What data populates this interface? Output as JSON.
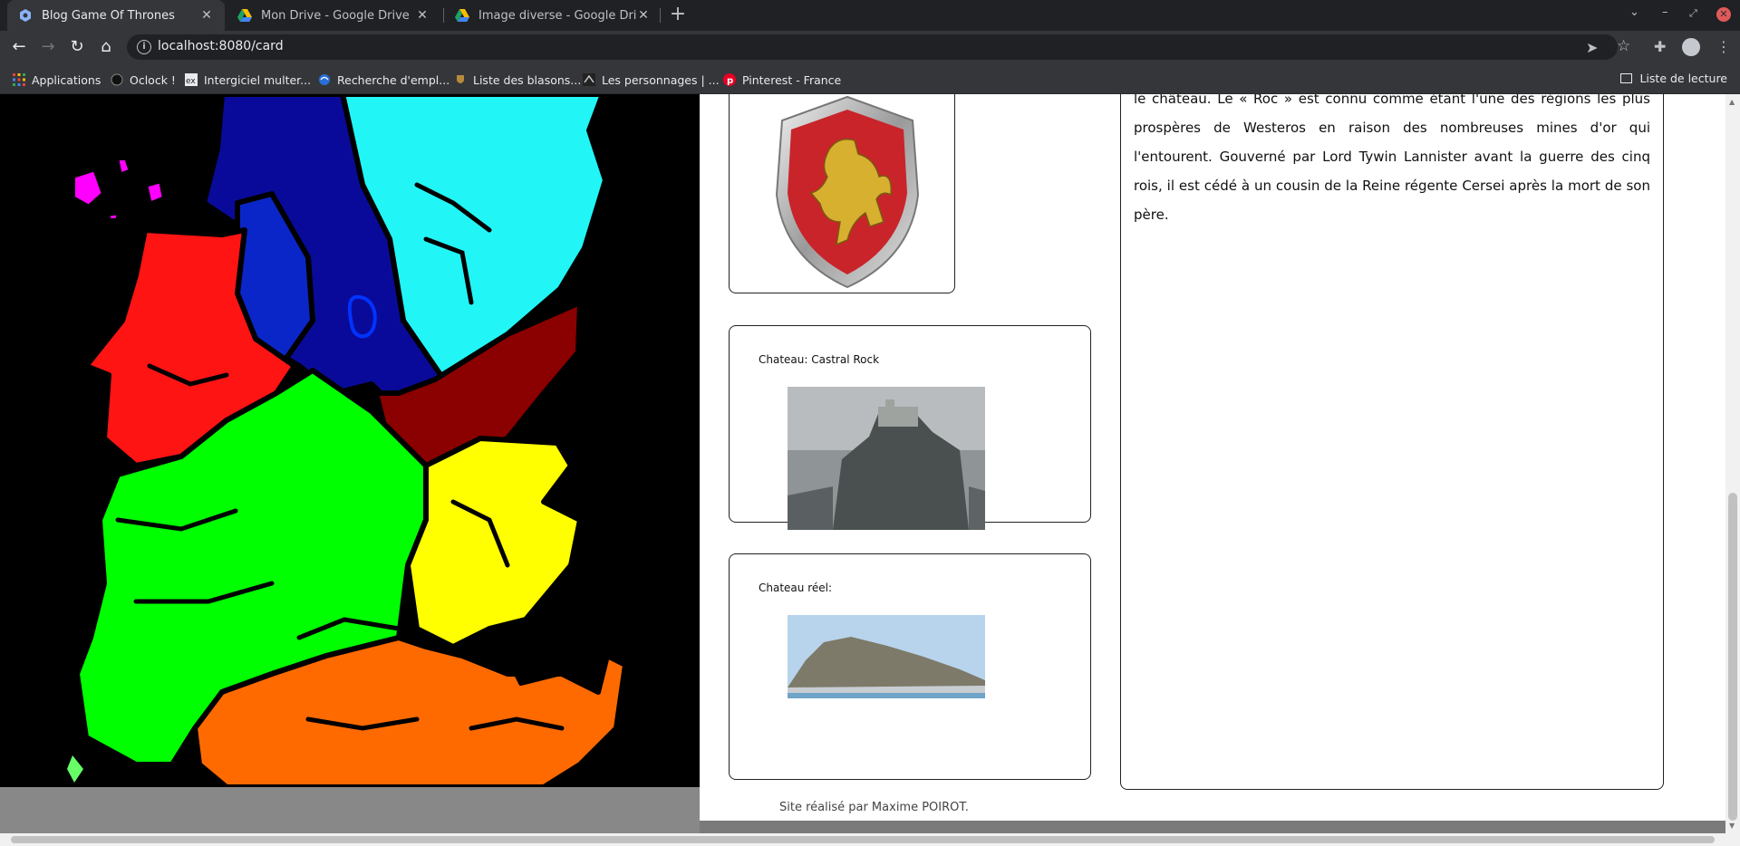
{
  "tabs": [
    {
      "title": "Blog Game Of Thrones",
      "icon": "app-icon",
      "active": true
    },
    {
      "title": "Mon Drive - Google Drive",
      "icon": "google-drive-icon",
      "active": false
    },
    {
      "title": "Image diverse - Google Drive",
      "icon": "google-drive-icon",
      "active": false
    }
  ],
  "address_bar": {
    "url": "localhost:8080/card"
  },
  "bookmarks": [
    {
      "label": "Applications",
      "icon": "apps-grid-icon"
    },
    {
      "label": "Oclock !",
      "icon": "oclock-icon"
    },
    {
      "label": "Intergiciel multer...",
      "icon": "ex-icon"
    },
    {
      "label": "Recherche d'empl...",
      "icon": "globe-icon"
    },
    {
      "label": "Liste des blasons...",
      "icon": "blason-icon"
    },
    {
      "label": "Les personnages | ...",
      "icon": "got-icon"
    },
    {
      "label": "Pinterest - France",
      "icon": "pinterest-icon"
    }
  ],
  "reading_list": "Liste de lecture",
  "castle_card": {
    "label": "Chateau: Castral Rock"
  },
  "real_castle_card": {
    "label": "Chateau réel:"
  },
  "description": "le château. Le « Roc » est connu comme étant l'une des régions les plus prospères de Westeros en raison des nombreuses mines d'or qui l'entourent. Gouverné par Lord Tywin Lannister avant la guerre des cinq rois, il est cédé à un cousin de la Reine régente Cersei après la mort de son père.",
  "footer": "Site réalisé par Maxime POIROT.",
  "colors": {
    "chrome_dark": "#202124",
    "chrome": "#35363a",
    "region_north": "#22f5f5",
    "region_vale": "#0a0a9a",
    "region_riverlands": "#ff1414",
    "region_westerlands": "#00ff00",
    "region_reach": "#ffff00",
    "region_stormlands": "#ff6a00",
    "region_crownlands": "#8b0000",
    "region_iron_islands": "#ff00ff",
    "shield_red": "#c8242a",
    "lion_gold": "#d8b030"
  }
}
